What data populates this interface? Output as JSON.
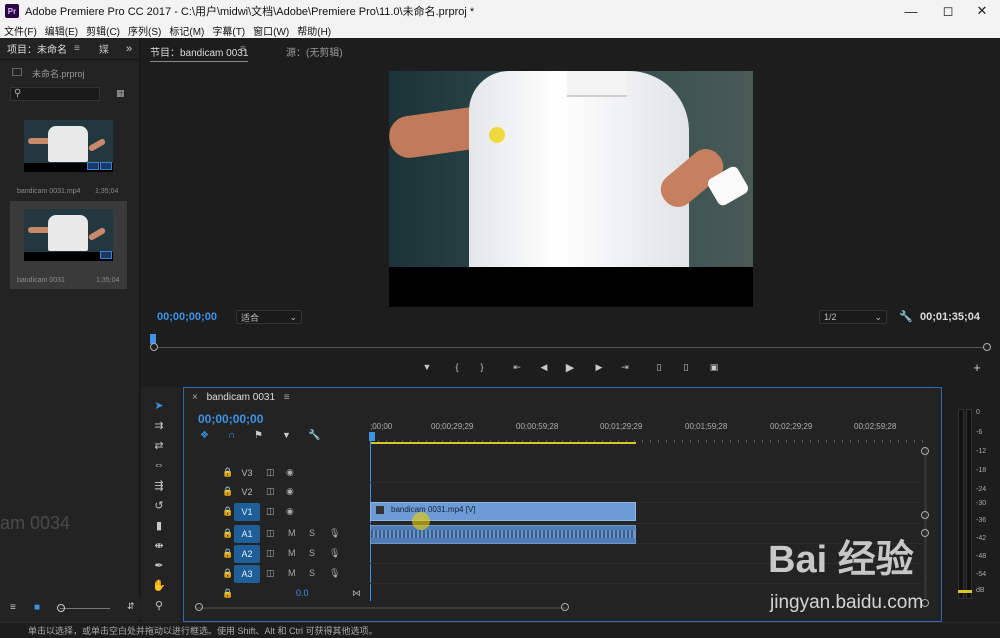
{
  "window": {
    "app_icon": "Pr",
    "title": "Adobe Premiere Pro CC 2017 - C:\\用户\\midwi\\文档\\Adobe\\Premiere Pro\\11.0\\未命名.prproj *",
    "controls": [
      "minimize-icon",
      "maximize-icon",
      "close-icon"
    ]
  },
  "menu": [
    "文件(F)",
    "编辑(E)",
    "剪辑(C)",
    "序列(S)",
    "标记(M)",
    "字幕(T)",
    "窗口(W)",
    "帮助(H)"
  ],
  "project_panel": {
    "tab_active": "项目：未命名",
    "tab_other": "媒",
    "project_file": "未命名.prproj",
    "search_placeholder": "",
    "items": [
      {
        "name": "bandicam 0031.mp4",
        "duration": "1;35;04"
      },
      {
        "name": "bandicam 0031",
        "duration": "1;35;04"
      }
    ]
  },
  "program_monitor": {
    "tab_active": "节目：bandicam 0031",
    "tab_other": "源：(无剪辑)",
    "timecode_current": "00;00;00;00",
    "fit": "适合",
    "resolution": "1/2",
    "timecode_duration": "00;01;35;04",
    "controls": [
      "marker-icon",
      "in-point-icon",
      "out-point-icon",
      "go-to-in-icon",
      "step-back-icon",
      "play-icon",
      "step-forward-icon",
      "go-to-out-icon",
      "lift-icon",
      "extract-icon",
      "export-frame-icon",
      "add-button-icon"
    ]
  },
  "timeline": {
    "tab": "bandicam 0031",
    "timecode": "00;00;00;00",
    "ruler_labels": [
      ";00;00",
      "00;00;29;29",
      "00;00;59;28",
      "00;01;29;29",
      "00;01;59;28",
      "00;02;29;29",
      "00;02;59;28"
    ],
    "tracks": [
      {
        "id": "V3",
        "selected": false
      },
      {
        "id": "V2",
        "selected": false
      },
      {
        "id": "V1",
        "selected": true
      },
      {
        "id": "A1",
        "selected": true
      },
      {
        "id": "A2",
        "selected": true
      },
      {
        "id": "A3",
        "selected": true
      }
    ],
    "m_label": "M",
    "s_label": "S",
    "master_value": "0.0",
    "video_clip": "bandicam 0031.mp4 [V]"
  },
  "meters": {
    "db_labels": [
      "0",
      "-6",
      "-12",
      "-18",
      "-24",
      "-30",
      "-36",
      "-42",
      "-48",
      "-54",
      "dB"
    ]
  },
  "status_bar": "单击以选择，或单击空白处并拖动以进行框选。使用 Shift、Alt 和 Ctrl 可获得其他选项。",
  "ghost_text": "am 0034",
  "watermark": {
    "logo": "Bai 经验",
    "url": "jingyan.baidu.com"
  },
  "colors": {
    "accent": "#3d93e8",
    "clip_video": "#6d9bd6",
    "clip_audio": "#4f7cb5",
    "track_on": "#1f5f99",
    "playhead": "#3d93e8",
    "work_area": "#d6c629"
  }
}
